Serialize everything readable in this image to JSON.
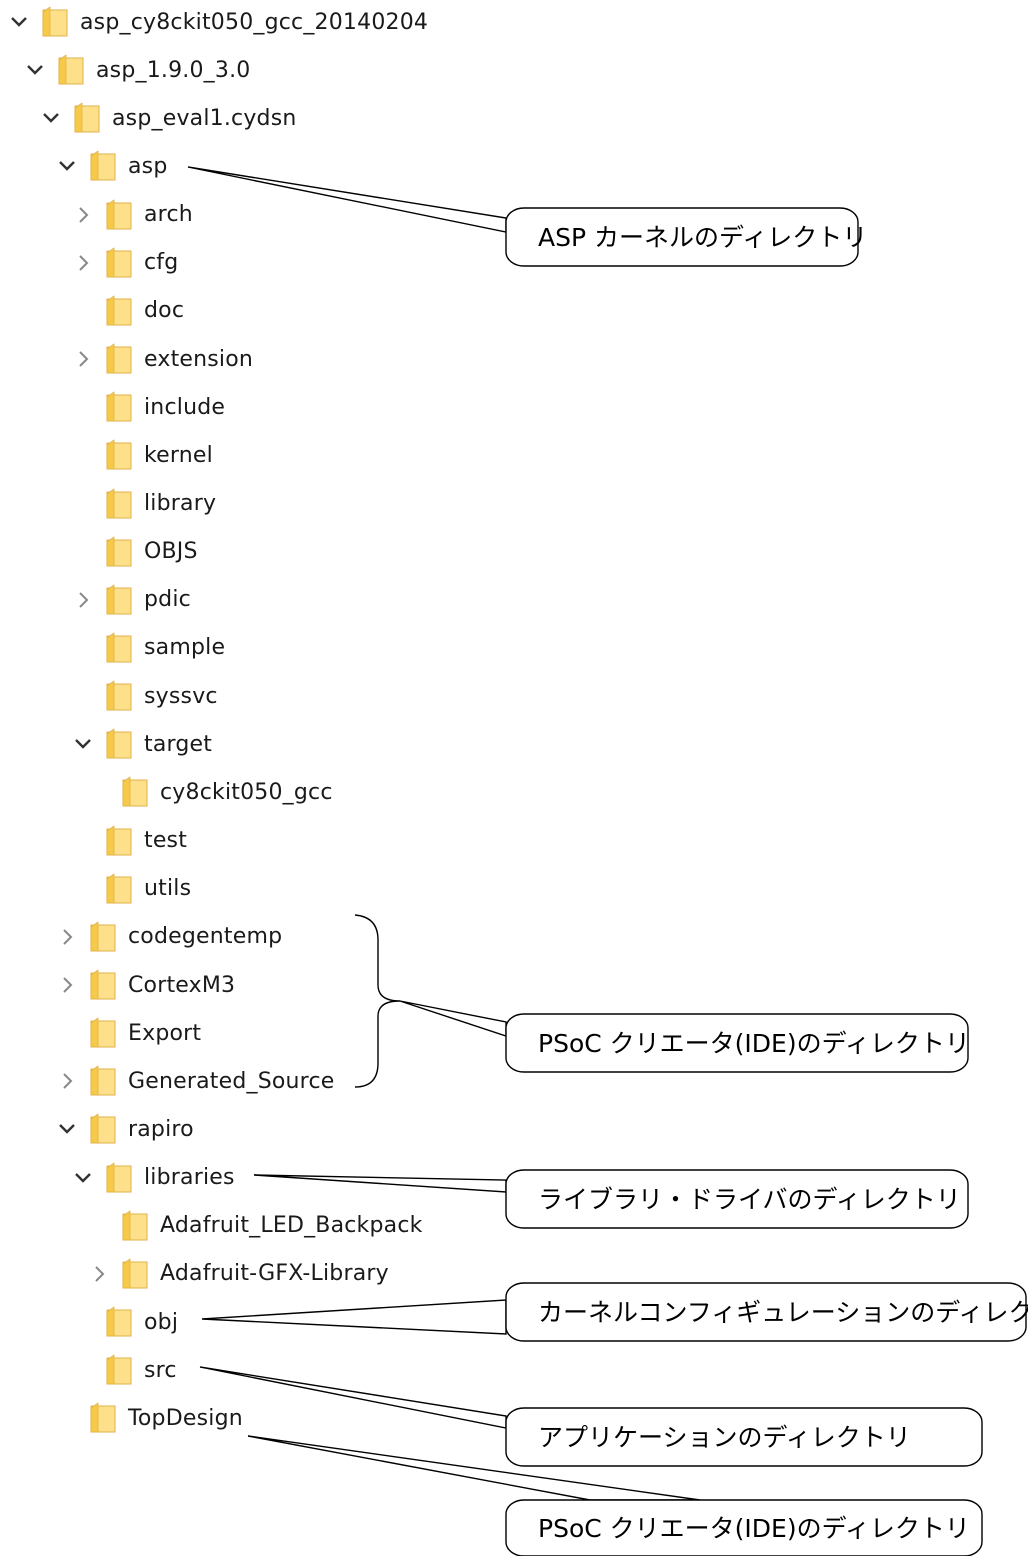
{
  "tree": [
    {
      "label": "asp_cy8ckit050_gcc_20140204",
      "depth": 0,
      "state": "expanded"
    },
    {
      "label": "asp_1.9.0_3.0",
      "depth": 1,
      "state": "expanded"
    },
    {
      "label": "asp_eval1.cydsn",
      "depth": 2,
      "state": "expanded"
    },
    {
      "label": "asp",
      "depth": 3,
      "state": "expanded"
    },
    {
      "label": "arch",
      "depth": 4,
      "state": "collapsed"
    },
    {
      "label": "cfg",
      "depth": 4,
      "state": "collapsed"
    },
    {
      "label": "doc",
      "depth": 4,
      "state": "none"
    },
    {
      "label": "extension",
      "depth": 4,
      "state": "collapsed"
    },
    {
      "label": "include",
      "depth": 4,
      "state": "none"
    },
    {
      "label": "kernel",
      "depth": 4,
      "state": "none"
    },
    {
      "label": "library",
      "depth": 4,
      "state": "none"
    },
    {
      "label": "OBJS",
      "depth": 4,
      "state": "none"
    },
    {
      "label": "pdic",
      "depth": 4,
      "state": "collapsed"
    },
    {
      "label": "sample",
      "depth": 4,
      "state": "none"
    },
    {
      "label": "syssvc",
      "depth": 4,
      "state": "none"
    },
    {
      "label": "target",
      "depth": 4,
      "state": "expanded"
    },
    {
      "label": "cy8ckit050_gcc",
      "depth": 5,
      "state": "none"
    },
    {
      "label": "test",
      "depth": 4,
      "state": "none"
    },
    {
      "label": "utils",
      "depth": 4,
      "state": "none"
    },
    {
      "label": "codegentemp",
      "depth": 3,
      "state": "collapsed"
    },
    {
      "label": "CortexM3",
      "depth": 3,
      "state": "collapsed"
    },
    {
      "label": "Export",
      "depth": 3,
      "state": "none"
    },
    {
      "label": "Generated_Source",
      "depth": 3,
      "state": "collapsed"
    },
    {
      "label": "rapiro",
      "depth": 3,
      "state": "expanded"
    },
    {
      "label": "libraries",
      "depth": 4,
      "state": "expanded"
    },
    {
      "label": "Adafruit_LED_Backpack",
      "depth": 5,
      "state": "none"
    },
    {
      "label": "Adafruit-GFX-Library",
      "depth": 5,
      "state": "collapsed"
    },
    {
      "label": "obj",
      "depth": 4,
      "state": "none"
    },
    {
      "label": "src",
      "depth": 4,
      "state": "none"
    },
    {
      "label": "TopDesign",
      "depth": 3,
      "state": "none"
    }
  ],
  "callouts": [
    {
      "text": "ASP カーネルのディレクトリ"
    },
    {
      "text": "PSoC クリエータ(IDE)のディレクトリ"
    },
    {
      "text": "ライブラリ・ドライバのディレクトリ"
    },
    {
      "text": "カーネルコンフィギュレーションのディレクトリ"
    },
    {
      "text": "アプリケーションのディレクトリ"
    },
    {
      "text": "PSoC クリエータ(IDE)のディレクトリ"
    }
  ],
  "colors": {
    "folder_body": "#FFE08A",
    "folder_edge": "#E0B24A",
    "chevron": "#333333",
    "callout_stroke": "#000000"
  }
}
